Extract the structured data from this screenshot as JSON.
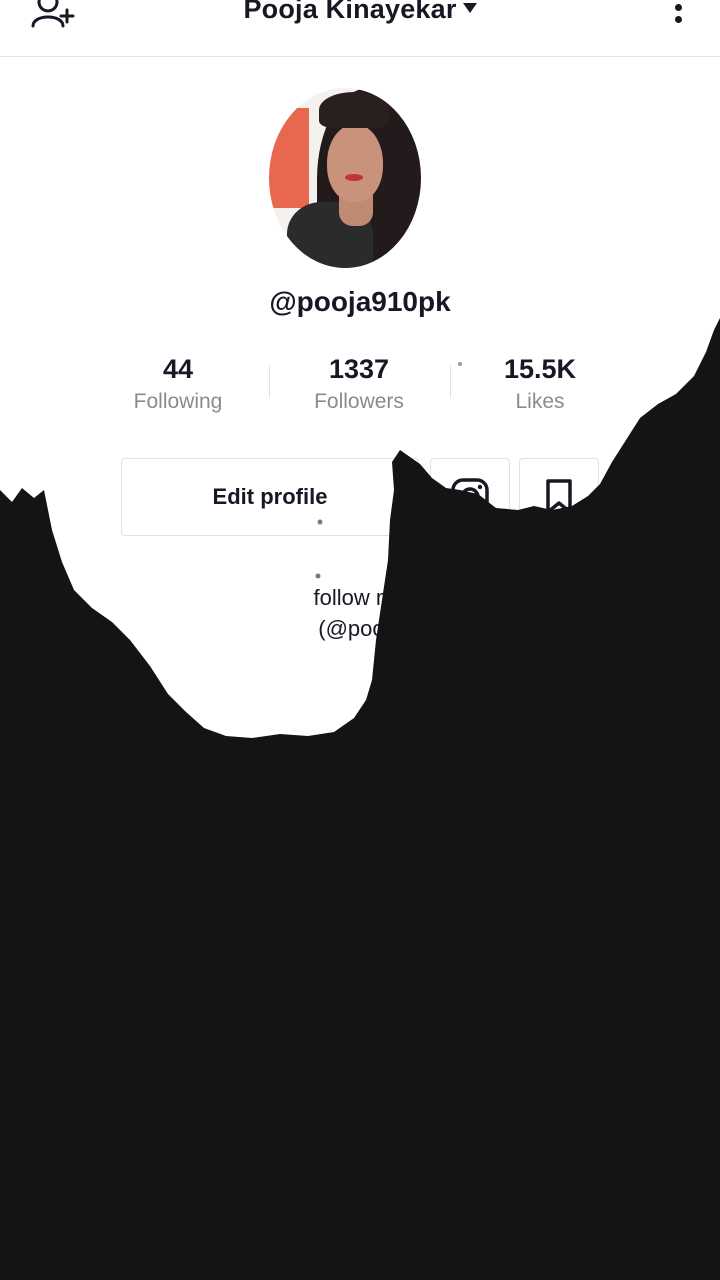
{
  "header": {
    "title": "Pooja Kinayekar",
    "add_user_icon": "add-user-icon",
    "more_icon": "more-vertical-icon",
    "dropdown_icon": "caret-down-icon"
  },
  "profile": {
    "username": "@pooja910pk",
    "avatar_icon": "profile-photo"
  },
  "stats": [
    {
      "value": "44",
      "label": "Following"
    },
    {
      "value": "1337",
      "label": "Followers"
    },
    {
      "value": "15.5K",
      "label": "Likes"
    }
  ],
  "actions": {
    "edit_profile_label": "Edit profile",
    "instagram_icon": "instagram-icon",
    "bookmark_icon": "bookmark-icon"
  },
  "bio": {
    "line1": "follow me",
    "line2": "(@pooja"
  },
  "colors": {
    "text": "#161823",
    "secondary_text": "#8a8b91",
    "border": "#e1e1e3",
    "ink_overlay": "#141316"
  }
}
